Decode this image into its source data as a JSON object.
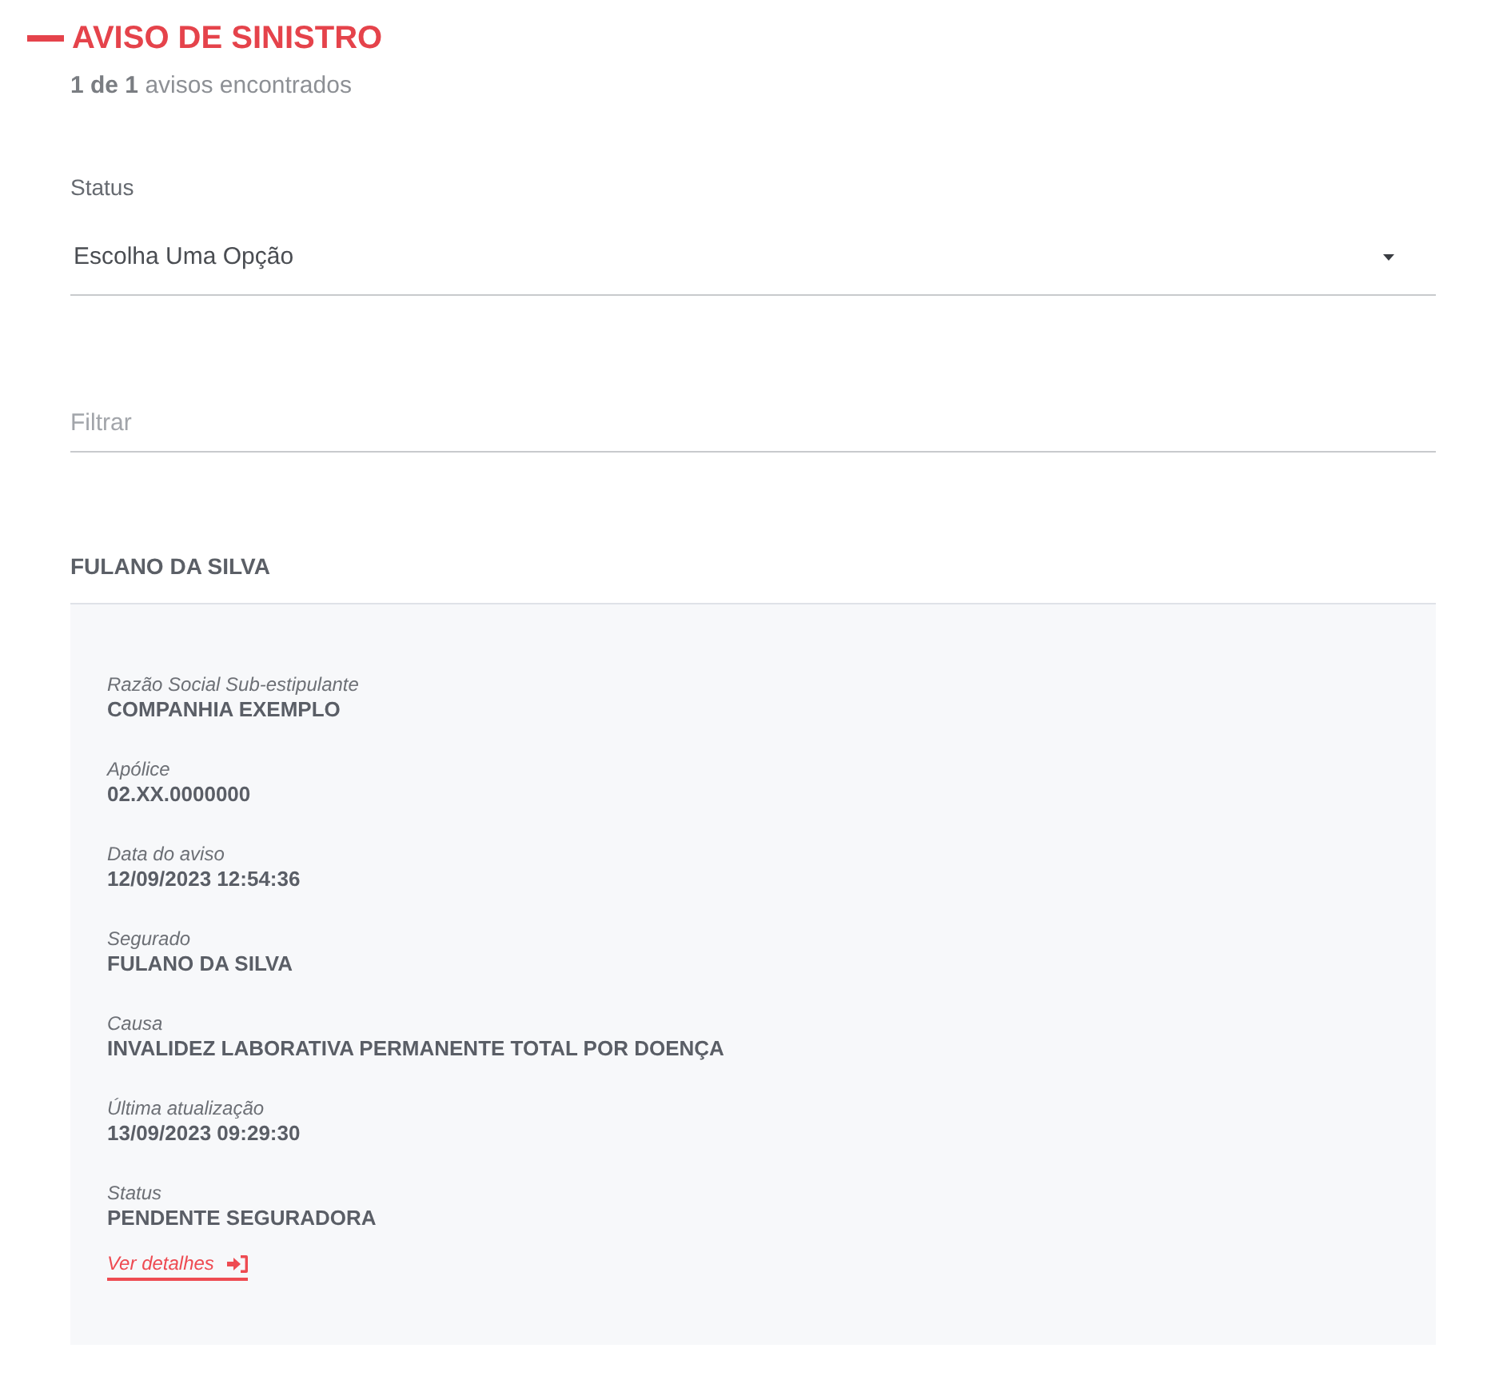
{
  "header": {
    "title": "AVISO DE SINISTRO",
    "summary": "**1 de 1** avisos encontrados"
  },
  "status_filter": {
    "label": "Status",
    "value": "Escolha Uma Opção"
  },
  "filter": {
    "placeholder": "Filtrar"
  },
  "results": [
    {
      "name": "FULANO DA SILVA",
      "fields": [
        {
          "label": "Razão Social Sub-estipulante",
          "value": "COMPANHIA EXEMPLO"
        },
        {
          "label": "Apólice",
          "value": "02.XX.0000000"
        },
        {
          "label": "Data do aviso",
          "value": "12/09/2023 12:54:36"
        },
        {
          "label": "Segurado",
          "value": "FULANO DA SILVA"
        },
        {
          "label": "Causa",
          "value": "INVALIDEZ LABORATIVA PERMANENTE TOTAL POR DOENÇA"
        },
        {
          "label": "Última atualização",
          "value": "13/09/2023 09:29:30"
        },
        {
          "label": "Status",
          "value": "PENDENTE SEGURADORA"
        }
      ],
      "link": "Ver detalhes"
    }
  ]
}
